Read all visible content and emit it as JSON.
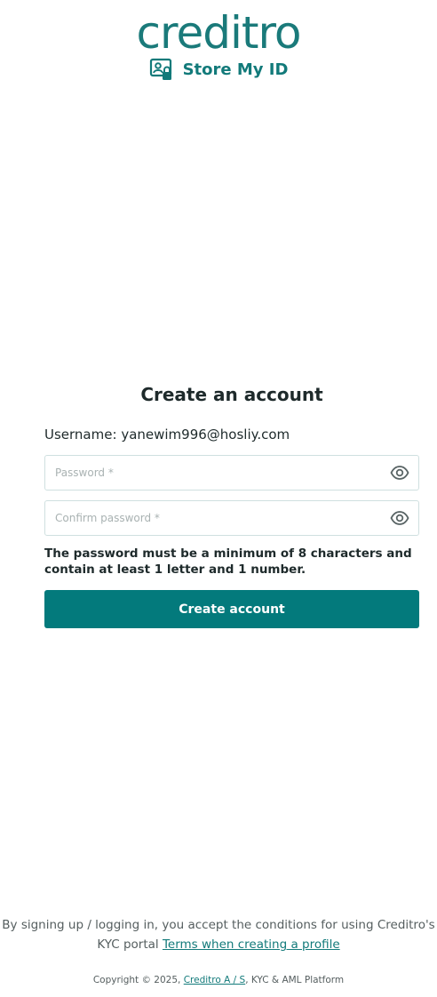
{
  "brand": {
    "logo_text": "creditro",
    "product_name": "Store My ID",
    "accent_color": "#037a7c"
  },
  "form": {
    "title": "Create an account",
    "username_label": "Username:",
    "username_value": "yanewim996@hosliy.com",
    "password_placeholder": "Password *",
    "confirm_placeholder": "Confirm password *",
    "password_hint": "The password must be a minimum of 8 characters and contain at least 1 letter and 1 number.",
    "submit_label": "Create account",
    "eye_icon": "eye-icon"
  },
  "footer": {
    "terms_text": "By signing up / logging in, you accept the conditions for using Creditro's KYC portal",
    "terms_link": "Terms when creating a profile",
    "copyright_prefix": "Copyright © 2025,",
    "company_link": "Creditro A / S",
    "copyright_suffix": ", KYC & AML Platform"
  }
}
